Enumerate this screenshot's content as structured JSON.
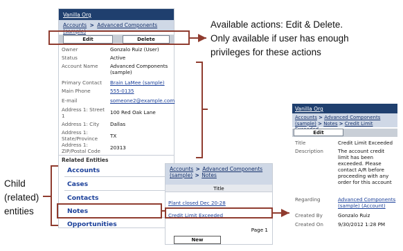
{
  "account_panel": {
    "header": "Vanilla Org",
    "breadcrumb": [
      "Accounts",
      ">",
      "Advanced Components (sample)"
    ],
    "edit_label": "Edit",
    "delete_label": "Delete",
    "fields": [
      {
        "label": "Owner",
        "value": "Gonzalo Ruiz (User)"
      },
      {
        "label": "Status",
        "value": "Active"
      },
      {
        "label": "Account Name",
        "value": "Advanced Components (sample)"
      },
      {
        "label": "Primary Contact",
        "value": "Brain LaMee (sample)"
      },
      {
        "label": "Main Phone",
        "value": "555-0135"
      },
      {
        "label": "E-mail",
        "value": "someone2@example.com"
      },
      {
        "label": "Address 1: Street 1",
        "value": "100 Red Oak Lane"
      },
      {
        "label": "Address 1: City",
        "value": "Dallas"
      },
      {
        "label": "Address 1: State/Province",
        "value": "TX"
      },
      {
        "label": "Address 1: ZIP/Postal Code",
        "value": "20313"
      }
    ],
    "related_title": "Related Entities",
    "related": [
      "Accounts",
      "Cases",
      "Contacts",
      "Notes",
      "Opportunities"
    ]
  },
  "notes_panel": {
    "breadcrumb": [
      "Accounts",
      ">",
      "Advanced Components (sample)",
      ">",
      "Notes"
    ],
    "column": "Title",
    "items": [
      "Plant closed Dec 20-28",
      "Credit Limit Exceeded"
    ],
    "page": "Page 1",
    "new_label": "New"
  },
  "note_panel": {
    "header": "Vanilla Org",
    "breadcrumb": [
      "Accounts",
      ">",
      "Advanced Components (sample)",
      ">",
      "Notes",
      ">",
      "Credit Limit Exceeded"
    ],
    "edit_label": "Edit",
    "fields": [
      {
        "label": "Title",
        "value": "Credit Limit Exceeded"
      },
      {
        "label": "Description",
        "value": "The account credit limit has been exceeded. Please contact A/R before proceeding with any order for this account"
      },
      {
        "label": "Regarding",
        "value": "Advanced Components (sample) (Account)"
      },
      {
        "label": "Created By",
        "value": "Gonzalo Ruiz"
      },
      {
        "label": "Created On",
        "value": "9/30/2012 1:28 PM"
      }
    ]
  },
  "annotations": {
    "actions": "Available  actions: Edit & Delete. Only available  if user has enough privileges for these actions",
    "actions_lines": [
      "Available  actions: Edit & Delete.",
      "Only available  if user has enough",
      "privileges for these actions"
    ],
    "child_lines": [
      "Child",
      "(related)",
      "entities"
    ]
  },
  "colors": {
    "header": "#1f3f6e",
    "link": "#1a3f99",
    "annotation_frame": "#8f3b2e"
  }
}
